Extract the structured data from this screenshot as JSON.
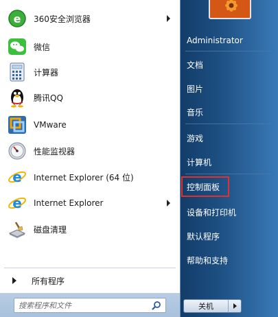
{
  "programs": [
    {
      "label": "360安全浏览器",
      "icon": "360-browser-icon",
      "submenu": true
    },
    {
      "label": "微信",
      "icon": "wechat-icon",
      "submenu": false
    },
    {
      "label": "计算器",
      "icon": "calculator-icon",
      "submenu": false
    },
    {
      "label": "腾讯QQ",
      "icon": "qq-penguin-icon",
      "submenu": false
    },
    {
      "label": "VMware",
      "icon": "vmware-icon",
      "submenu": false
    },
    {
      "label": "性能监视器",
      "icon": "performance-monitor-icon",
      "submenu": false
    },
    {
      "label": "Internet Explorer (64 位)",
      "icon": "internet-explorer-icon",
      "submenu": false
    },
    {
      "label": "Internet Explorer",
      "icon": "internet-explorer-icon",
      "submenu": true
    },
    {
      "label": "磁盘清理",
      "icon": "disk-cleanup-icon",
      "submenu": false
    }
  ],
  "all_programs": {
    "label": "所有程序"
  },
  "search": {
    "placeholder": "搜索程序和文件"
  },
  "places": [
    {
      "label": "Administrator"
    },
    {
      "label": "文档"
    },
    {
      "label": "图片"
    },
    {
      "label": "音乐"
    },
    {
      "label": "游戏"
    },
    {
      "label": "计算机"
    },
    {
      "label": "控制面板",
      "highlighted": true
    },
    {
      "label": "设备和打印机"
    },
    {
      "label": "默认程序"
    },
    {
      "label": "帮助和支持"
    }
  ],
  "shutdown": {
    "label": "关机"
  },
  "colors": {
    "right_pane": "#1d4f82",
    "highlight_border": "#e0312d",
    "search_strip": "#b8cde4"
  }
}
